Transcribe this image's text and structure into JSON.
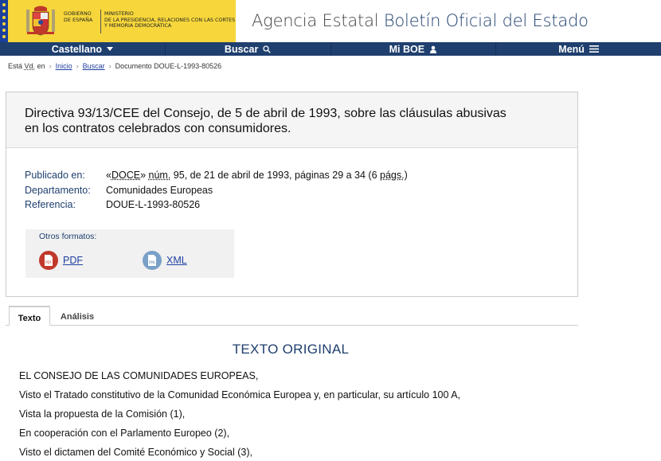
{
  "header": {
    "gov_text": [
      "GOBIERNO",
      "DE ESPAÑA"
    ],
    "ministry_text": [
      "MINISTERIO",
      "DE LA PRESIDENCIA, RELACIONES CON LAS CORTES",
      "Y MEMORIA DEMOCRÁTICA"
    ],
    "agency_plain": "Agencia Estatal",
    "agency_bold": "Boletín Oficial del Estado"
  },
  "nav": {
    "language": "Castellano",
    "search": "Buscar",
    "mi_boe": "Mi BOE",
    "menu": "Menú"
  },
  "breadcrumb": {
    "prefix": "Está",
    "vd": "Vd.",
    "en": "en",
    "home": "Inicio",
    "search": "Buscar",
    "current": "Documento DOUE-L-1993-80526"
  },
  "document": {
    "title_line1": "Directiva 93/13/CEE del Consejo, de 5 de abril de 1993, sobre las cláusulas abusivas",
    "title_line2": "en los contratos celebrados con consumidores.",
    "published_label": "Publicado en:",
    "published_open": "«",
    "published_doce": "DOCE",
    "published_close": "» ",
    "published_num": "núm.",
    "published_rest": " 95, de 21 de abril de 1993, páginas 29 a 34 (6 ",
    "published_pags": "págs.",
    "published_end": ")",
    "department_label": "Departamento:",
    "department_value": "Comunidades Europeas",
    "reference_label": "Referencia:",
    "reference_value": "DOUE-L-1993-80526"
  },
  "formats": {
    "title": "Otros formatos:",
    "pdf": "PDF",
    "xml": "XML",
    "pdf_color": "#c0392b",
    "xml_color": "#7aa0c8"
  },
  "tabs": {
    "texto": "Texto",
    "analisis": "Análisis"
  },
  "body": {
    "heading": "TEXTO ORIGINAL",
    "paragraphs": [
      "EL CONSEJO DE LAS COMUNIDADES EUROPEAS,",
      "Visto el Tratado constitutivo de la Comunidad Económica Europea y, en particular, su artículo 100 A,",
      "Vista la propuesta de la Comisión (1),",
      "En cooperación con el Parlamento Europeo (2),",
      "Visto el dictamen del Comité Económico y Social (3),"
    ]
  },
  "colors": {
    "nav_bg": "#1f3f6e",
    "gov_yellow": "#f6d63b",
    "eu_blue": "#1b3f9c",
    "link": "#1f3f9f"
  }
}
